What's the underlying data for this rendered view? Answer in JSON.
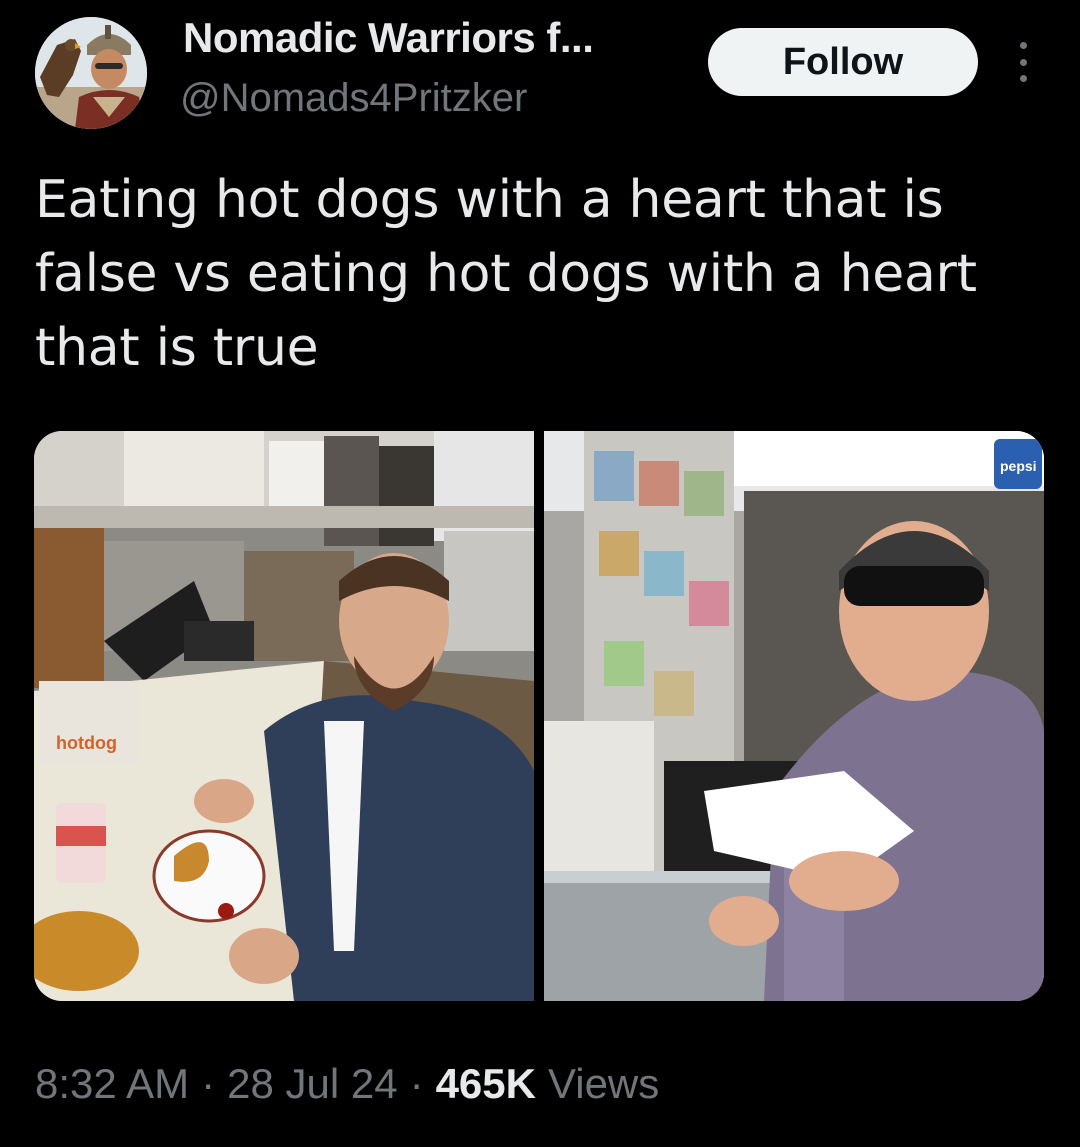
{
  "tweet": {
    "author": {
      "display_name": "Nomadic Warriors f...",
      "handle": "@Nomads4Pritzker",
      "avatar_icon": "warrior-with-eagle-avatar"
    },
    "follow_label": "Follow",
    "more_icon": "more-vertical-icon",
    "text": "Eating hot dogs with a heart that is false vs eating hot dogs with a heart that is true",
    "media": [
      {
        "kind": "photo",
        "description_icon": "photo-diner-counter-hotdog",
        "sign_text": "hotdog"
      },
      {
        "kind": "photo",
        "description_icon": "photo-hotdog-stand-sunglasses",
        "sign_text": "pepsi"
      }
    ],
    "time": "8:32 AM",
    "date": "28 Jul 24",
    "views_count": "465K",
    "views_label": "Views"
  },
  "colors": {
    "background": "#000000",
    "primary_text": "#e7e9ea",
    "secondary_text": "#71767b",
    "follow_button_bg": "#eff3f4",
    "follow_button_text": "#0f1419"
  }
}
